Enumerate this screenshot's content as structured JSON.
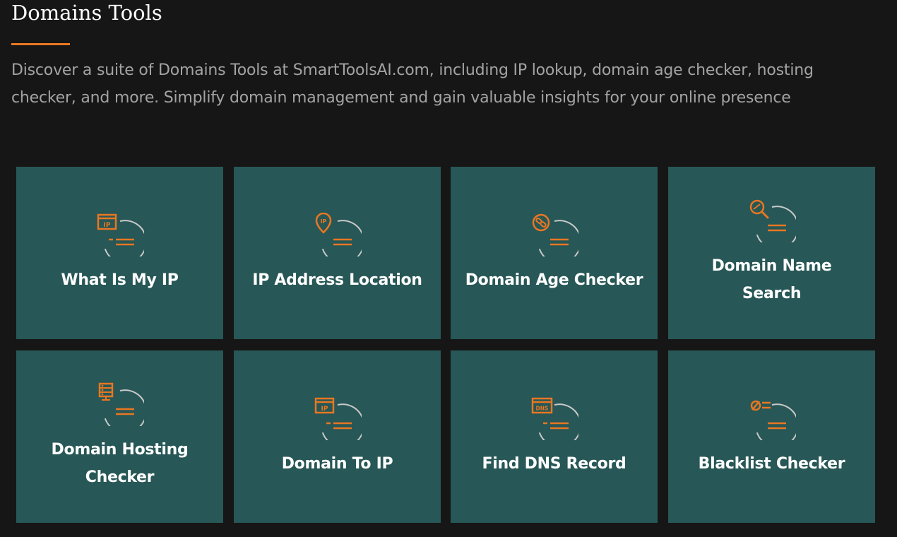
{
  "section": {
    "title": "Domains Tools",
    "description": "Discover a suite of Domains Tools at SmartToolsAI.com, including IP lookup, domain age checker, hosting checker, and more. Simplify domain management and gain valuable insights for your online presence"
  },
  "colors": {
    "background": "#161616",
    "card": "#275756",
    "accent": "#e87722",
    "icon_ring": "#c9c9c9",
    "title": "#ffffff",
    "description": "#a3a3a3"
  },
  "tools": [
    {
      "label": "What Is My IP",
      "icon": "ip-window-icon"
    },
    {
      "label": "IP Address Location",
      "icon": "ip-location-pin-icon"
    },
    {
      "label": "Domain Age Checker",
      "icon": "link-clock-icon"
    },
    {
      "label": "Domain Name Search",
      "icon": "magnifier-search-icon"
    },
    {
      "label": "Domain Hosting Checker",
      "icon": "server-rack-icon"
    },
    {
      "label": "Domain To IP",
      "icon": "ip-window-icon"
    },
    {
      "label": "Find DNS Record",
      "icon": "dns-window-icon"
    },
    {
      "label": "Blacklist Checker",
      "icon": "blacklist-list-icon"
    }
  ]
}
